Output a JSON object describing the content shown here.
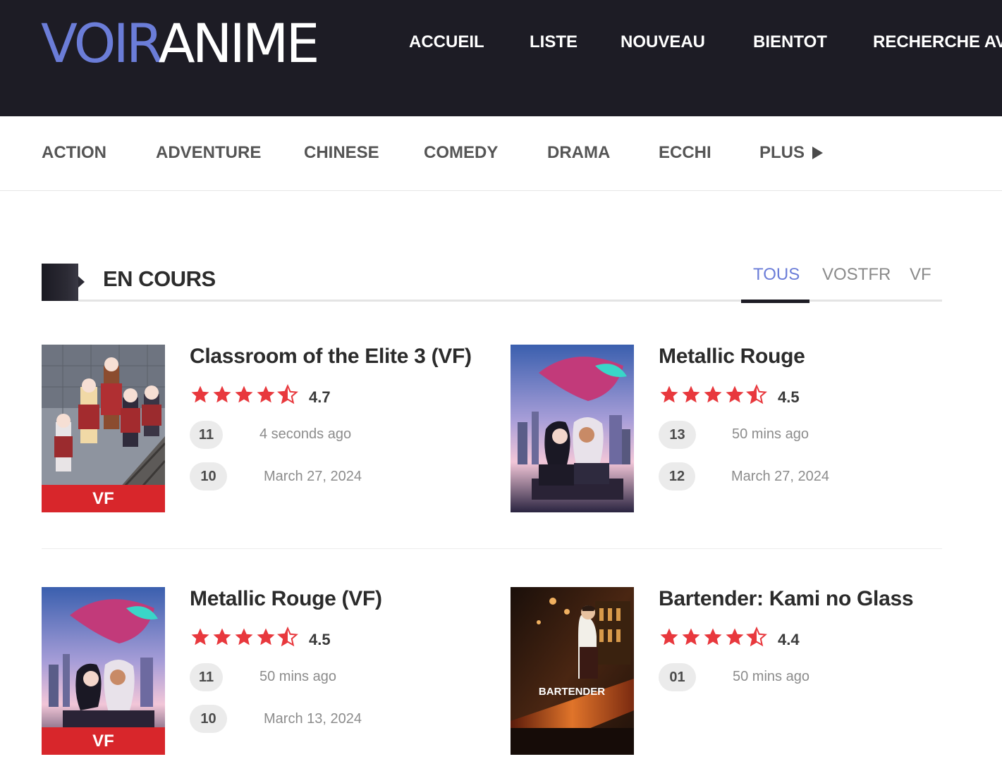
{
  "header": {
    "logo_part1": "VOIR",
    "logo_part2": "ANIME",
    "nav": [
      "ACCUEIL",
      "LISTE",
      "NOUVEAU",
      "BIENTOT",
      "RECHERCHE AV"
    ]
  },
  "genres": {
    "items": [
      "ACTION",
      "ADVENTURE",
      "CHINESE",
      "COMEDY",
      "DRAMA",
      "ECCHI"
    ],
    "more_label": "PLUS"
  },
  "section": {
    "title": "EN COURS",
    "tabs": [
      "TOUS",
      "VOSTFR",
      "VF"
    ],
    "active_tab": "TOUS"
  },
  "cards": [
    {
      "title": "Classroom of the Elite 3 (VF)",
      "rating": "4.7",
      "badge": "VF",
      "episodes": [
        {
          "num": "11",
          "time": "4 seconds ago"
        },
        {
          "num": "10",
          "time": "March 27, 2024"
        }
      ]
    },
    {
      "title": "Metallic Rouge",
      "rating": "4.5",
      "badge": "",
      "episodes": [
        {
          "num": "13",
          "time": "50 mins ago"
        },
        {
          "num": "12",
          "time": "March 27, 2024"
        }
      ]
    },
    {
      "title": "Metallic Rouge (VF)",
      "rating": "4.5",
      "badge": "VF",
      "episodes": [
        {
          "num": "11",
          "time": "50 mins ago"
        },
        {
          "num": "10",
          "time": "March 13, 2024"
        }
      ]
    },
    {
      "title": "Bartender: Kami no Glass",
      "rating": "4.4",
      "badge": "",
      "poster_text": "BARTENDER",
      "episodes": [
        {
          "num": "01",
          "time": "50 mins ago"
        }
      ]
    }
  ],
  "colors": {
    "header_bg": "#1d1c25",
    "accent": "#6b7dd8",
    "star": "#e8383d",
    "badge": "#d8262b"
  }
}
